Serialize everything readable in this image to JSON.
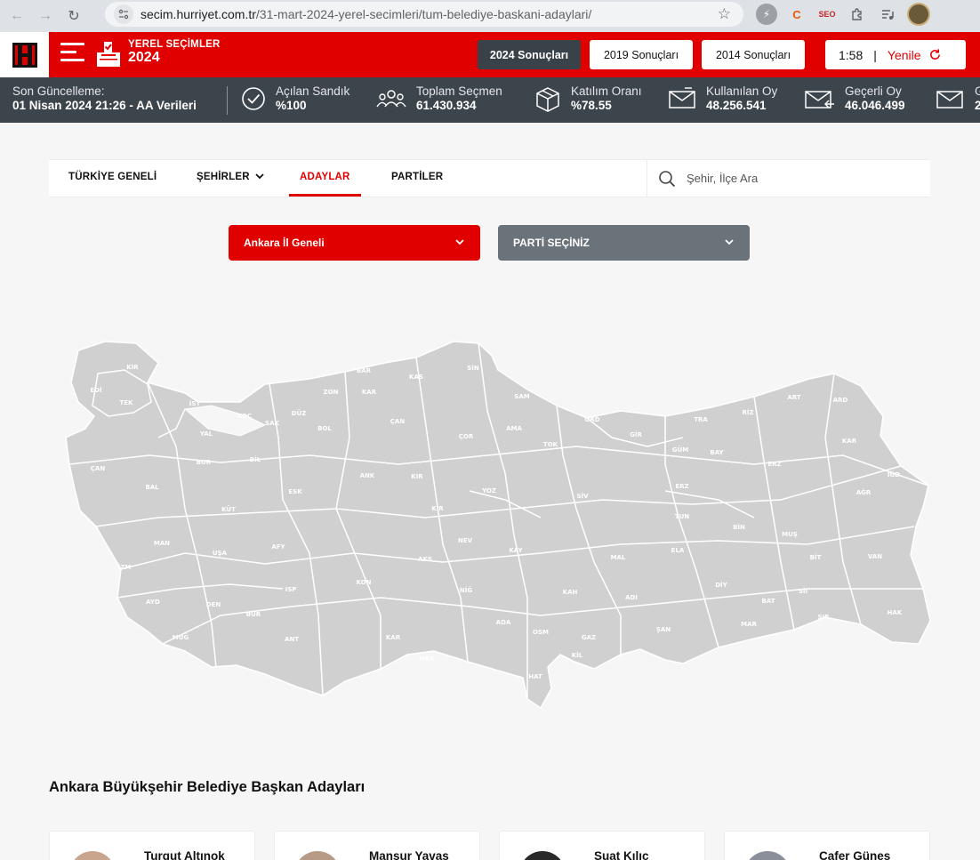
{
  "browser": {
    "url_domain": "secim.hurriyet.com.tr",
    "url_path": "/31-mart-2024-yerel-secimleri/tum-belediye-baskani-adaylari/",
    "extensions": [
      "lightning-icon",
      "c-extension-icon",
      "seo-extension-icon",
      "puzzle-icon",
      "media-control-icon"
    ]
  },
  "header": {
    "brand": "H",
    "election_label": "YEREL SEÇİMLER",
    "election_year": "2024",
    "year_buttons": [
      {
        "label": "2024 Sonuçları",
        "active": true
      },
      {
        "label": "2019 Sonuçları",
        "active": false
      },
      {
        "label": "2014 Sonuçları",
        "active": false
      }
    ],
    "timer": "1:58",
    "refresh_label": "Yenile"
  },
  "stats": {
    "last_update_label": "Son Güncelleme:",
    "last_update_value": "01 Nisan 2024 21:26 - AA Verileri",
    "items": [
      {
        "label": "Açılan Sandık",
        "value": "%100",
        "icon": "check-circle-icon"
      },
      {
        "label": "Toplam Seçmen",
        "value": "61.430.934",
        "icon": "people-icon"
      },
      {
        "label": "Katılım Oranı",
        "value": "%78.55",
        "icon": "box-icon"
      },
      {
        "label": "Kullanılan Oy",
        "value": "48.256.541",
        "icon": "envelope-in-icon"
      },
      {
        "label": "Geçerli Oy",
        "value": "46.046.499",
        "icon": "envelope-check-icon"
      },
      {
        "label": "G",
        "value": "2",
        "icon": "envelope-out-icon"
      }
    ]
  },
  "tabs": [
    {
      "label": "TÜRKİYE GENELİ",
      "active": false
    },
    {
      "label": "ŞEHİRLER",
      "active": false
    },
    {
      "label": "ADAYLAR",
      "active": true
    },
    {
      "label": "PARTİLER",
      "active": false
    }
  ],
  "search": {
    "placeholder": "Şehir, İlçe Ara"
  },
  "filters": {
    "city_selected": "Ankara İl Geneli",
    "party_selected": "PARTİ SEÇİNİZ"
  },
  "map": {
    "provinces": [
      "KIR",
      "EDİ",
      "TEK",
      "İST",
      "KOC",
      "DÜZ",
      "ZON",
      "BAR",
      "KAR",
      "KAS",
      "SİN",
      "SAM",
      "ORD",
      "AMA",
      "ÇOR",
      "ÇAN",
      "BOL",
      "SAK",
      "YAL",
      "BUR",
      "BİL",
      "ESK",
      "ANK",
      "KIR",
      "YOZ",
      "TOK",
      "GİR",
      "TRA",
      "RİZ",
      "ART",
      "ARD",
      "KAR",
      "IĞD",
      "AĞR",
      "ERZ",
      "BAY",
      "GÜM",
      "ERZ",
      "TUN",
      "SİV",
      "KIR",
      "NEV",
      "KAY",
      "MAL",
      "ELA",
      "BİN",
      "MUŞ",
      "BİT",
      "VAN",
      "DİY",
      "SİI",
      "BAT",
      "ŞIR",
      "HAK",
      "MAR",
      "ŞAN",
      "ADI",
      "KAH",
      "GAZ",
      "KİL",
      "OSM",
      "HAT",
      "ADA",
      "NİĞ",
      "AKS",
      "KON",
      "KAR",
      "MER",
      "ISP",
      "BUR",
      "ANT",
      "AFY",
      "UŞA",
      "KÜT",
      "BAL",
      "ÇAN",
      "MAN",
      "İZM",
      "AYD",
      "DEN",
      "MUĞ"
    ],
    "fill_color": "#d0d0d0"
  },
  "candidates": {
    "title": "Ankara Büyükşehir Belediye Başkan Adayları",
    "items": [
      {
        "name": "Turgut Altınok"
      },
      {
        "name": "Mansur Yavaş"
      },
      {
        "name": "Suat Kılıç"
      },
      {
        "name": "Cafer Güneş"
      }
    ]
  },
  "colors": {
    "accent": "#e00000",
    "dark": "#3d454c",
    "map": "#d0d0d0"
  }
}
